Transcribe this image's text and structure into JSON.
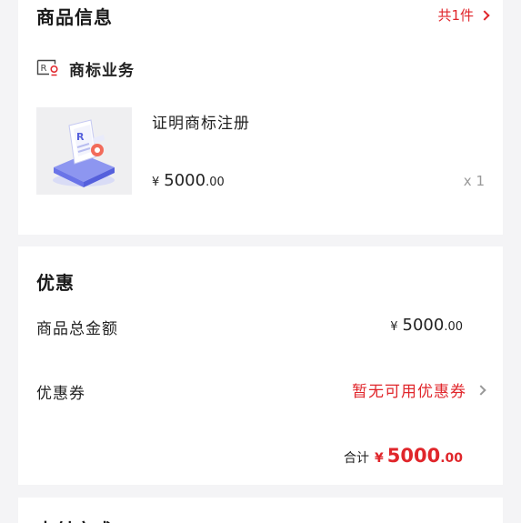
{
  "goods": {
    "title": "商品信息",
    "count": "共1件",
    "business_label": "商标业务",
    "product": {
      "name": "证明商标注册",
      "currency": "¥",
      "price_int": "5000",
      "price_dec": ".00",
      "qty": "x 1"
    }
  },
  "discount": {
    "title": "优惠",
    "total_label": "商品总金额",
    "total_currency": "¥",
    "total_int": "5000",
    "total_dec": ".00",
    "coupon_label": "优惠券",
    "coupon_value": "暂无可用优惠券",
    "sum_label": "合计",
    "sum_currency": "¥",
    "sum_int": "5000",
    "sum_dec": ".00"
  },
  "payment": {
    "title": "支付方式"
  },
  "colors": {
    "accent": "#e0262b",
    "background": "#f4f4f6",
    "card": "#ffffff",
    "muted": "#999999"
  },
  "icons": {
    "business": "trademark-registered-icon",
    "product": "trademark-certificate-illustration"
  }
}
